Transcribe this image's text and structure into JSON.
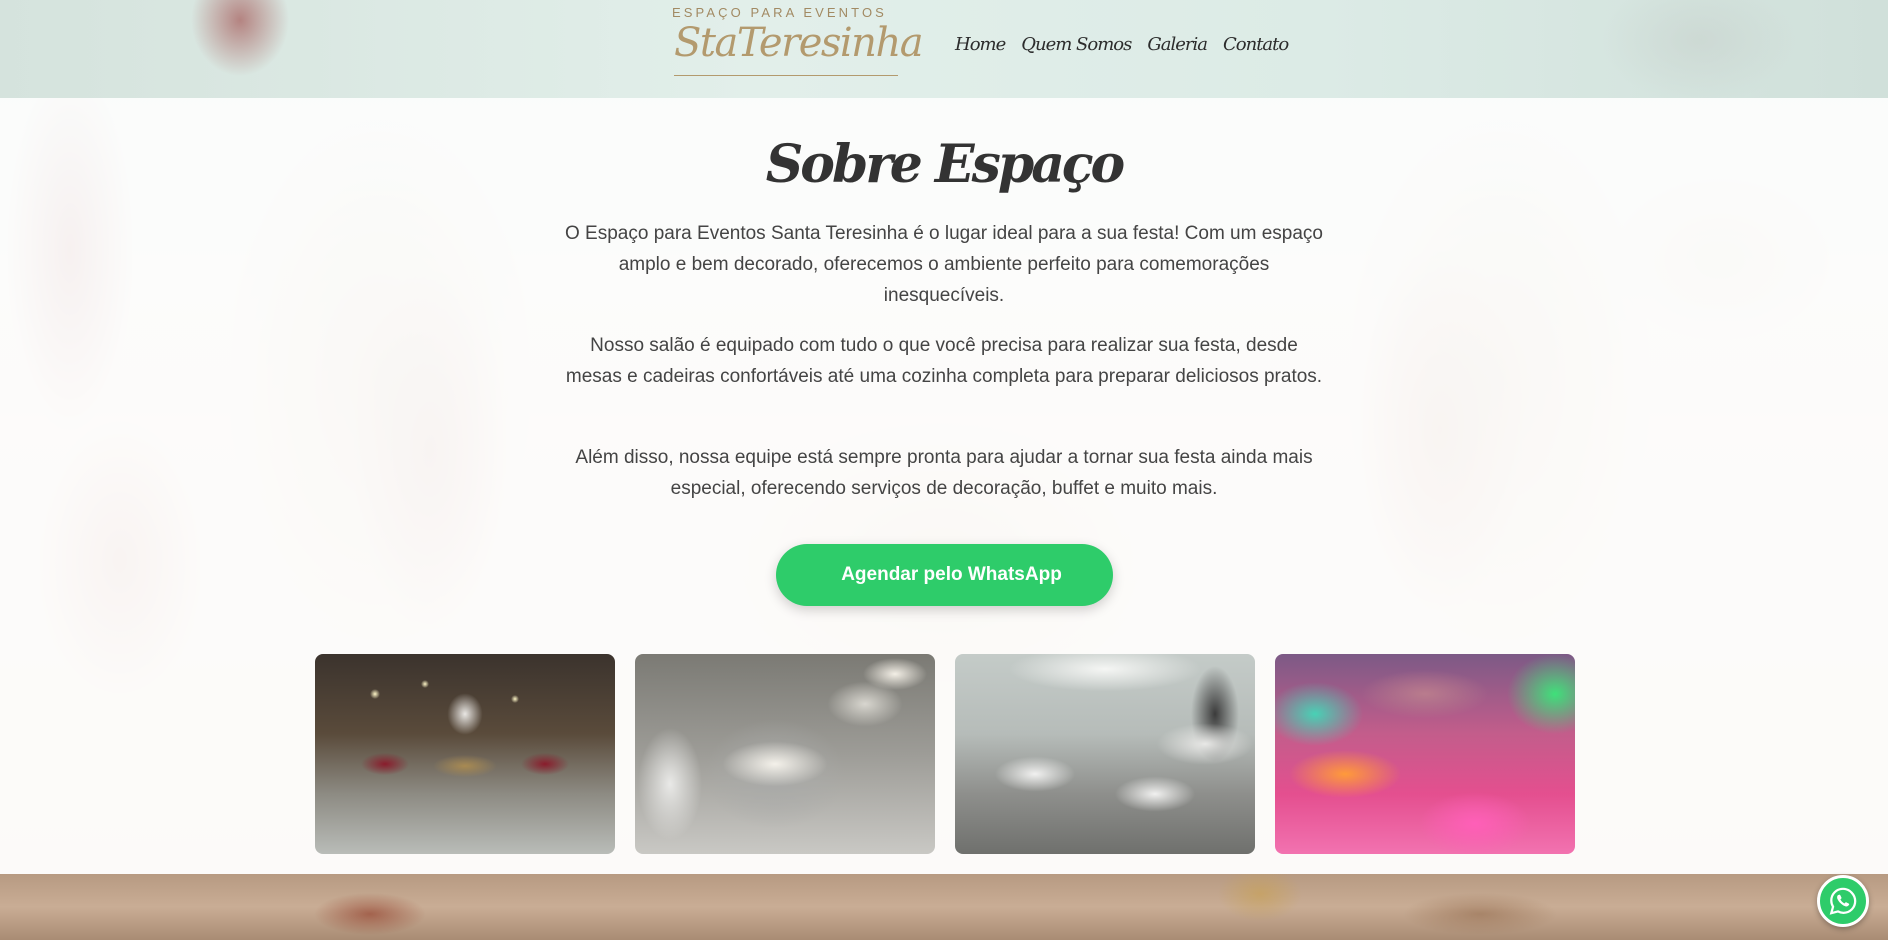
{
  "header": {
    "logo_top": "ESPAÇO PARA EVENTOS",
    "logo_script": "StaTeresinha",
    "nav": [
      "Home",
      "Quem Somos",
      "Galeria",
      "Contato"
    ]
  },
  "main": {
    "title": "Sobre Espaço",
    "paragraphs": [
      "O Espaço para Eventos Santa Teresinha é o lugar ideal para a sua festa! Com um espaço amplo e bem decorado, oferecemos o ambiente perfeito para comemorações inesquecíveis.",
      "Nosso salão é equipado com tudo o que você precisa para realizar sua festa, desde mesas e cadeiras confortáveis até uma cozinha completa para preparar deliciosos pratos.",
      "Além disso, nossa equipe está sempre pronta para ajudar a tornar sua festa ainda mais especial, oferecendo serviços de decoração, buffet e muito mais."
    ],
    "cta_label": "Agendar pelo WhatsApp"
  },
  "gallery": {
    "photos": [
      "cake-table-photo",
      "buffet-chafing-dish-photo",
      "banquet-hall-photo",
      "pink-lit-hall-photo"
    ]
  },
  "floating": {
    "icon": "whatsapp-icon",
    "color": "#2ecc6a"
  },
  "colors": {
    "accent": "#2ecc6a",
    "logo_gold": "#b39a6e"
  }
}
